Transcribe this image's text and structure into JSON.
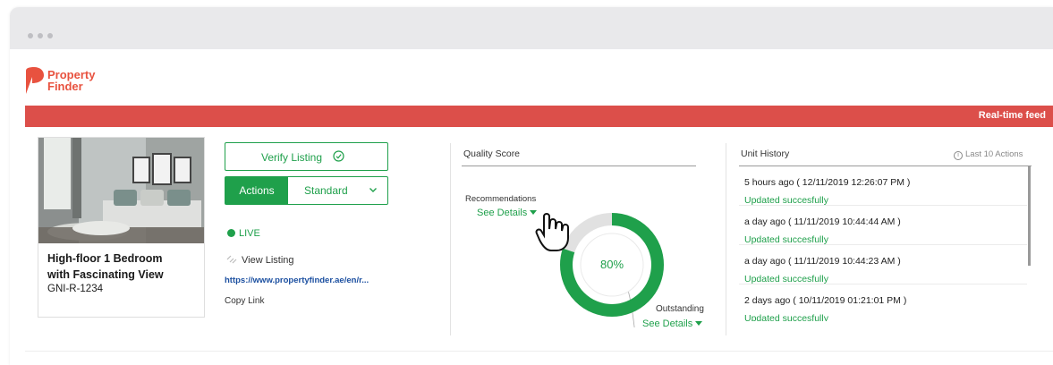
{
  "window": {
    "dots": 3
  },
  "brand": {
    "line1": "Property",
    "line2": "Finder",
    "color": "#e8523f"
  },
  "banner": {
    "label": "Real-time feed",
    "color": "#dc4f4a"
  },
  "listing": {
    "title_line1": "High-floor 1 Bedroom",
    "title_line2": "with Fascinating View",
    "ref": "GNI-R-1234"
  },
  "controls": {
    "verify_label": "Verify Listing",
    "actions_label": "Actions",
    "standard_label": "Standard",
    "status": "LIVE",
    "view_listing": "View Listing",
    "url": "https://www.propertyfinder.ae/en/r...",
    "copy_link": "Copy Link"
  },
  "quality": {
    "title": "Quality Score",
    "recommendations": "Recommendations",
    "see_details_1": "See Details",
    "score_text": "80%",
    "score": 0.8,
    "outstanding": "Outstanding",
    "see_details_2": "See Details"
  },
  "history": {
    "title": "Unit History",
    "last_actions": "Last 10 Actions",
    "items": [
      {
        "time": "5 hours ago ( 12/11/2019 12:26:07 PM )",
        "status": "Updated succesfully"
      },
      {
        "time": "a day ago ( 11/11/2019 10:44:44 AM )",
        "status": "Updated succesfully"
      },
      {
        "time": "a day ago ( 11/11/2019 10:44:23 AM )",
        "status": "Updated succesfully"
      },
      {
        "time": "2 days ago ( 10/11/2019 01:21:01 PM )",
        "status": "Updated succesfully"
      }
    ]
  },
  "colors": {
    "accent": "#1fa04b",
    "link": "#1b4fa0",
    "track": "#e1e1e1"
  }
}
